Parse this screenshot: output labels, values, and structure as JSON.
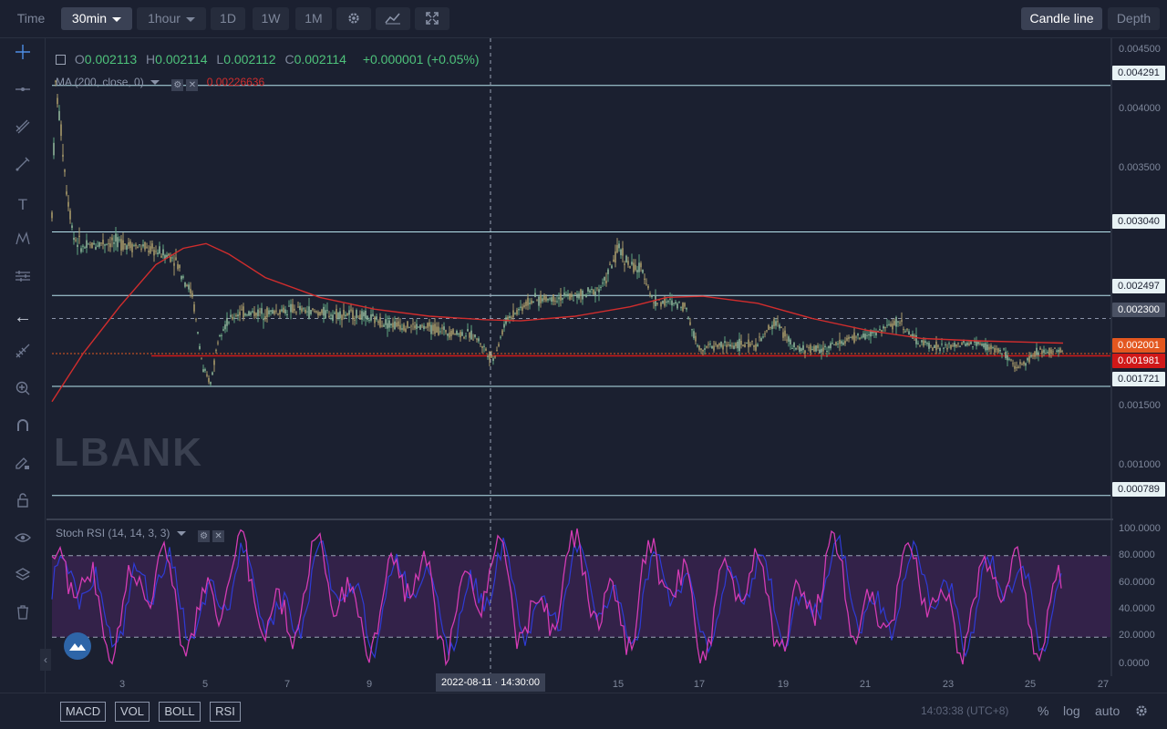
{
  "toolbar": {
    "time_label": "Time",
    "interval_label": "30min",
    "hour_label": "1hour",
    "d1_label": "1D",
    "w1_label": "1W",
    "m1_label": "1M",
    "candle_line_label": "Candle line",
    "depth_label": "Depth"
  },
  "left_tools": [
    "crosshair-icon",
    "horizontal-line-icon",
    "multi-line-icon",
    "pen-icon",
    "text-icon",
    "pattern-icon",
    "ruler-icon",
    "arrow-left-icon",
    "fib-icon",
    "zoom-in-icon",
    "magnet-icon",
    "pencil-lock-icon",
    "lock-icon",
    "eye-icon",
    "layers-icon",
    "trash-icon"
  ],
  "ohlc": {
    "o_key": "O",
    "o_val": "0.002113",
    "h_key": "H",
    "h_val": "0.002114",
    "l_key": "L",
    "l_val": "0.002112",
    "c_key": "C",
    "c_val": "0.002114",
    "change": "+0.000001 (+0.05%)"
  },
  "ma_legend": {
    "label": "MA (200, close, 0)",
    "value": "0.00226636"
  },
  "rsi_legend": {
    "label": "Stoch RSI (14, 14, 3, 3)"
  },
  "watermark": "LBANK",
  "price_axis": {
    "ticks": [
      "0.004500",
      "0.004000",
      "0.003500",
      "0.001500",
      "0.001000"
    ],
    "tags": [
      {
        "text": "0.004291",
        "style": "hline"
      },
      {
        "text": "0.003040",
        "style": "hline"
      },
      {
        "text": "0.002497",
        "style": "hline"
      },
      {
        "text": "0.002300",
        "style": "grey"
      },
      {
        "text": "0.002001",
        "style": "orange"
      },
      {
        "text": "0.001981",
        "style": "red"
      },
      {
        "text": "0.001721",
        "style": "hline"
      },
      {
        "text": "0.000789",
        "style": "hline"
      }
    ]
  },
  "rsi_axis": [
    "100.0000",
    "80.0000",
    "60.0000",
    "40.0000",
    "20.0000",
    "0.0000"
  ],
  "date_axis": [
    "3",
    "5",
    "7",
    "9",
    "15",
    "17",
    "19",
    "21",
    "23",
    "25",
    "27"
  ],
  "crosshair_date": "2022-08-11 · 14:30:00",
  "bottom": {
    "indicators": [
      "MACD",
      "VOL",
      "BOLL",
      "RSI"
    ],
    "clock": "14:03:38 (UTC+8)",
    "percent_label": "%",
    "log_label": "log",
    "auto_label": "auto"
  },
  "colors": {
    "background": "#1b2030",
    "ma_line": "#d12d2d",
    "rsi_k": "#d33bb4",
    "rsi_d": "#2f3bd6",
    "hline": "#b7e3ec",
    "candles": "#a89a6a"
  },
  "chart_data": {
    "type": "candlestick",
    "y_range": [
      0.0006,
      0.0046
    ],
    "horizontal_levels": [
      0.004291,
      0.00304,
      0.002497,
      0.0023,
      0.001721,
      0.000789
    ],
    "last_price": 0.002001,
    "ma200_last": 0.00226636,
    "rsi_ylim": [
      0,
      100
    ],
    "rsi_bands": [
      20,
      80
    ]
  }
}
